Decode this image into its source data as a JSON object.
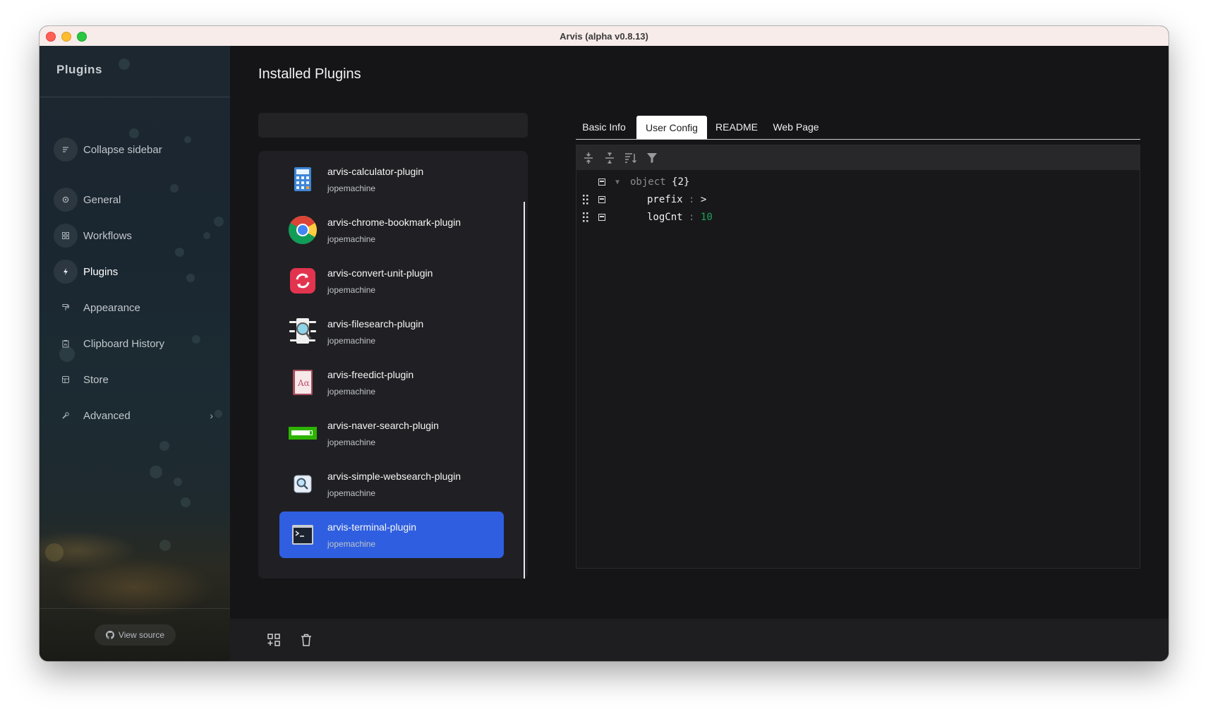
{
  "window": {
    "title": "Arvis (alpha v0.8.13)"
  },
  "sidebar": {
    "header": "Plugins",
    "items": [
      {
        "label": "Collapse sidebar",
        "icon": "collapse-icon"
      },
      {
        "label": "General",
        "icon": "gear-icon"
      },
      {
        "label": "Workflows",
        "icon": "grid-icon"
      },
      {
        "label": "Plugins",
        "icon": "bolt-icon"
      },
      {
        "label": "Appearance",
        "icon": "paint-roller-icon"
      },
      {
        "label": "Clipboard History",
        "icon": "clipboard-icon"
      },
      {
        "label": "Store",
        "icon": "store-icon"
      },
      {
        "label": "Advanced",
        "icon": "wrench-icon"
      }
    ],
    "active_item": "Plugins",
    "view_source": "View source"
  },
  "main": {
    "title": "Installed Plugins",
    "search": {
      "value": "",
      "placeholder": ""
    },
    "plugins": [
      {
        "name": "arvis-calculator-plugin",
        "author": "jopemachine",
        "icon": "calculator-icon"
      },
      {
        "name": "arvis-chrome-bookmark-plugin",
        "author": "jopemachine",
        "icon": "chrome-icon"
      },
      {
        "name": "arvis-convert-unit-plugin",
        "author": "jopemachine",
        "icon": "convert-icon"
      },
      {
        "name": "arvis-filesearch-plugin",
        "author": "jopemachine",
        "icon": "filesearch-icon"
      },
      {
        "name": "arvis-freedict-plugin",
        "author": "jopemachine",
        "icon": "dictionary-icon"
      },
      {
        "name": "arvis-naver-search-plugin",
        "author": "jopemachine",
        "icon": "naver-search-icon"
      },
      {
        "name": "arvis-simple-websearch-plugin",
        "author": "jopemachine",
        "icon": "magnifier-icon"
      },
      {
        "name": "arvis-terminal-plugin",
        "author": "jopemachine",
        "icon": "terminal-icon"
      }
    ],
    "selected_plugin": "arvis-terminal-plugin"
  },
  "tabs": {
    "items": [
      "Basic Info",
      "User Config",
      "README",
      "Web Page"
    ],
    "active": "User Config"
  },
  "editor": {
    "root_type": "object",
    "root_count": "{2}",
    "entries": [
      {
        "key": "prefix",
        "value": ">",
        "type": "string"
      },
      {
        "key": "logCnt",
        "value": "10",
        "type": "number"
      }
    ],
    "separator": ":"
  },
  "colors": {
    "accent": "#2f5fe0",
    "number_value": "#1fa35a"
  }
}
